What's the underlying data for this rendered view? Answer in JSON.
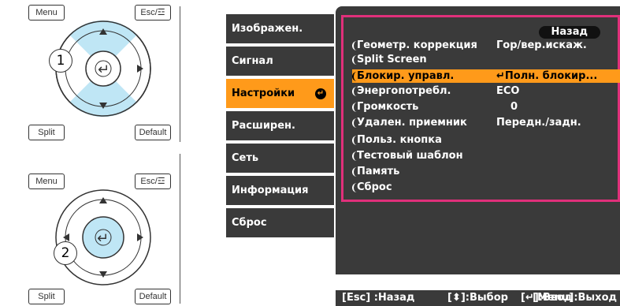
{
  "remote1": {
    "menu": "Menu",
    "esc": "Esc/☲",
    "split": "Split",
    "default": "Default",
    "step": "1",
    "enter_symbol": "↵"
  },
  "remote2": {
    "menu": "Menu",
    "esc": "Esc/☲",
    "split": "Split",
    "default": "Default",
    "step": "2",
    "enter_symbol": "↵"
  },
  "left_menu": [
    {
      "label": "Изображен."
    },
    {
      "label": "Сигнал"
    },
    {
      "label": "Настройки",
      "active": true
    },
    {
      "label": "Расширен."
    },
    {
      "label": "Сеть"
    },
    {
      "label": "Информация"
    },
    {
      "label": "Сброс"
    }
  ],
  "enter_icon": "↵",
  "main": {
    "back_label": "Назад",
    "rows": [
      {
        "label": "Геометр. коррекция",
        "value": "Гор/вер.искаж."
      },
      {
        "label": "Split Screen",
        "value": ""
      },
      {
        "label": "Блокир. управл.",
        "value": "↵Полн. блокир...",
        "selected": true
      },
      {
        "label": "Энергопотребл.",
        "value": "ECO"
      },
      {
        "label": "Громкость",
        "value": "0"
      },
      {
        "label": "Удален. приемник",
        "value": "Передн./задн."
      },
      {
        "label": "Польз. кнопка",
        "value": ""
      },
      {
        "label": "Тестовый шаблон",
        "value": ""
      },
      {
        "label": "Память",
        "value": ""
      },
      {
        "label": "Сброс",
        "value": ""
      }
    ]
  },
  "footer": {
    "esc": "[Esc] :Назад",
    "select": "[⬍]:Выбор",
    "enter": "[↵]:Ввод",
    "menu": "[Menu]:Выход"
  },
  "colors": {
    "menu_bg": "#3a3a3a",
    "highlight": "#ff9a1a",
    "frame": "#e0307a",
    "dial_arrow": "#bfe6f5"
  }
}
